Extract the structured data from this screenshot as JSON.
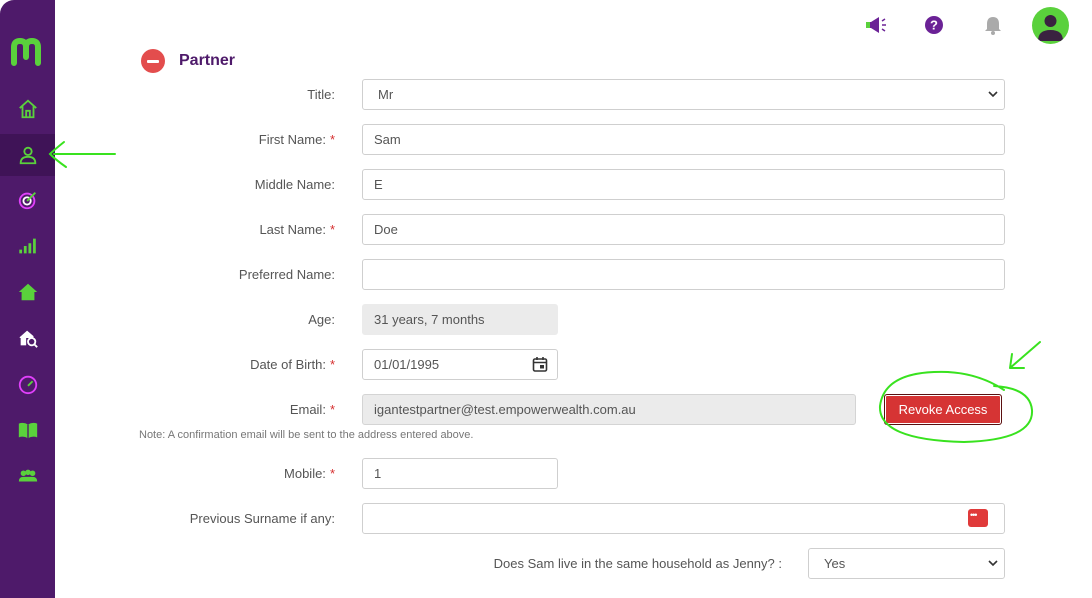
{
  "sidebar": {
    "logo": "m",
    "items": [
      {
        "name": "home-icon"
      },
      {
        "name": "user-icon",
        "active": true
      },
      {
        "name": "target-icon"
      },
      {
        "name": "chart-icon"
      },
      {
        "name": "house-icon"
      },
      {
        "name": "property-search-icon"
      },
      {
        "name": "gauge-icon"
      },
      {
        "name": "book-icon"
      },
      {
        "name": "team-icon"
      }
    ]
  },
  "topbar": {
    "icons": [
      "megaphone-icon",
      "help-icon",
      "bell-icon",
      "avatar"
    ]
  },
  "section": {
    "title": "Partner"
  },
  "form": {
    "title": {
      "label": "Title:",
      "value": "Mr"
    },
    "first_name": {
      "label": "First Name:",
      "required": "*",
      "value": "Sam"
    },
    "middle_name": {
      "label": "Middle Name:",
      "value": "E"
    },
    "last_name": {
      "label": "Last Name:",
      "required": "*",
      "value": "Doe"
    },
    "preferred_name": {
      "label": "Preferred Name:",
      "value": ""
    },
    "age": {
      "label": "Age:",
      "value": "31 years, 7 months"
    },
    "dob": {
      "label": "Date of Birth:",
      "required": "*",
      "value": "01/01/1995"
    },
    "email": {
      "label": "Email:",
      "required": "*",
      "value": "igantestpartner@test.empowerwealth.com.au"
    },
    "revoke_label": "Revoke Access",
    "note": "Note: A confirmation email will be sent to the address entered above.",
    "mobile": {
      "label": "Mobile:",
      "required": "*",
      "value": "1"
    },
    "previous_surname": {
      "label": "Previous Surname if any:",
      "value": ""
    },
    "household": {
      "label": "Does Sam live in the same household as Jenny? :",
      "value": "Yes"
    }
  },
  "colors": {
    "sidebar": "#4e1a6a",
    "accent": "#5ad13c",
    "danger": "#d63434",
    "title": "#4e1a6a"
  }
}
